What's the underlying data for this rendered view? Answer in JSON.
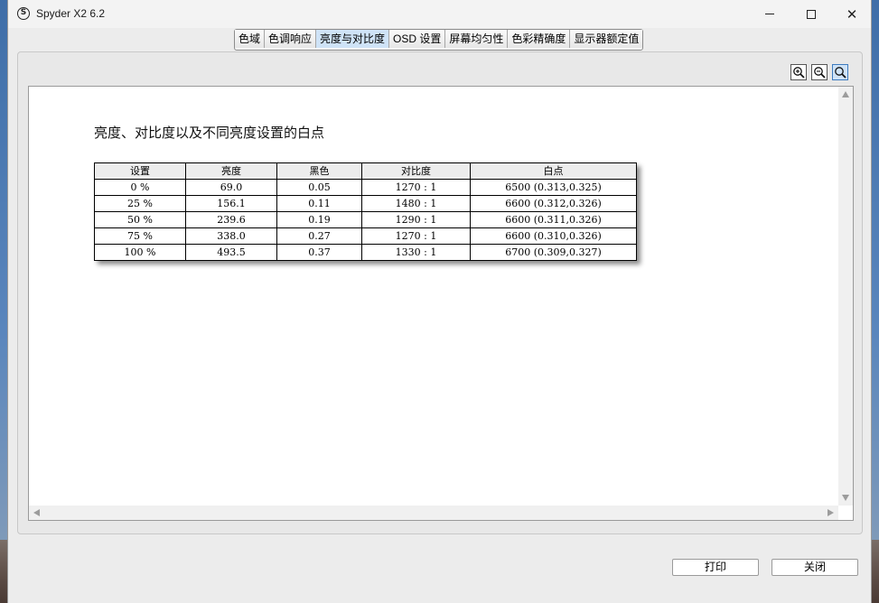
{
  "window": {
    "title": "Spyder X2 6.2",
    "app_icon_glyph": "S",
    "controls": {
      "minimize": "minimize-icon",
      "maximize": "maximize-icon",
      "close": "✕"
    }
  },
  "tabs": [
    {
      "label": "色域",
      "active": false
    },
    {
      "label": "色调响应",
      "active": false
    },
    {
      "label": "亮度与对比度",
      "active": true
    },
    {
      "label": "OSD 设置",
      "active": false
    },
    {
      "label": "屏幕均匀性",
      "active": false
    },
    {
      "label": "色彩精确度",
      "active": false
    },
    {
      "label": "显示器额定值",
      "active": false
    }
  ],
  "zoom_tools": [
    "zoom-in-icon",
    "zoom-out-icon",
    "zoom-fit-icon"
  ],
  "report": {
    "title": "亮度、对比度以及不同亮度设置的白点",
    "columns": [
      "设置",
      "亮度",
      "黑色",
      "对比度",
      "白点"
    ],
    "rows": [
      [
        "0 %",
        "69.0",
        "0.05",
        "1270 : 1",
        "6500 (0.313,0.325)"
      ],
      [
        "25 %",
        "156.1",
        "0.11",
        "1480 : 1",
        "6600 (0.312,0.326)"
      ],
      [
        "50 %",
        "239.6",
        "0.19",
        "1290 : 1",
        "6600 (0.311,0.326)"
      ],
      [
        "75 %",
        "338.0",
        "0.27",
        "1270 : 1",
        "6600 (0.310,0.326)"
      ],
      [
        "100 %",
        "493.5",
        "0.37",
        "1330 : 1",
        "6700 (0.309,0.327)"
      ]
    ]
  },
  "buttons": {
    "print": "打印",
    "close": "关闭"
  },
  "colors": {
    "active_tab": "#cfe3f7",
    "table_header": "#ececec"
  }
}
